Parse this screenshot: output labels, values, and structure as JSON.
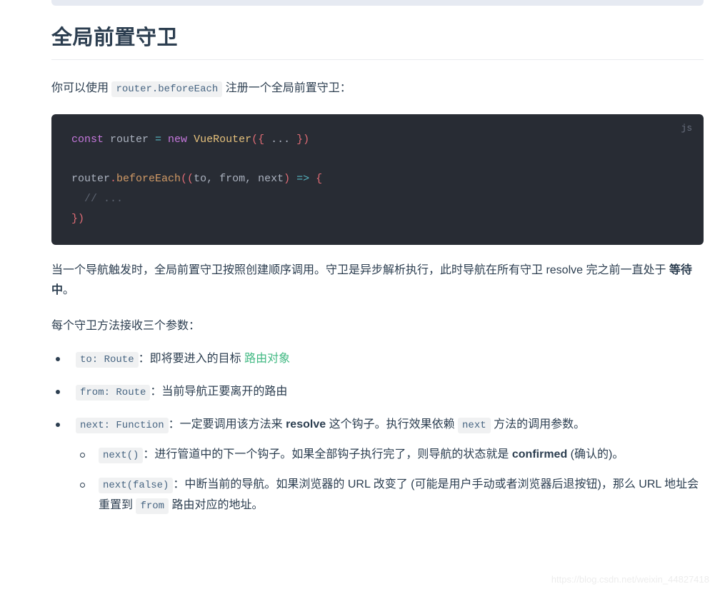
{
  "page": {
    "title": "全局前置守卫",
    "intro_before": "你可以使用",
    "intro_code": "router.beforeEach",
    "intro_after": "注册一个全局前置守卫："
  },
  "code_block": {
    "lang_label": "js",
    "lines": [
      {
        "tokens": [
          {
            "t": "const ",
            "c": "tok-kw"
          },
          {
            "t": "router ",
            "c": "tok-plain"
          },
          {
            "t": "= ",
            "c": "tok-arrow"
          },
          {
            "t": "new ",
            "c": "tok-kw"
          },
          {
            "t": "VueRouter",
            "c": "tok-cls"
          },
          {
            "t": "({ ",
            "c": "tok-punc"
          },
          {
            "t": "... ",
            "c": "tok-plain"
          },
          {
            "t": "})",
            "c": "tok-punc"
          }
        ]
      },
      {
        "tokens": []
      },
      {
        "tokens": [
          {
            "t": "router",
            "c": "tok-plain"
          },
          {
            "t": ".",
            "c": "tok-punc"
          },
          {
            "t": "beforeEach",
            "c": "tok-fn"
          },
          {
            "t": "((",
            "c": "tok-punc"
          },
          {
            "t": "to, from, next",
            "c": "tok-plain"
          },
          {
            "t": ")",
            "c": "tok-punc"
          },
          {
            "t": " => ",
            "c": "tok-arrow"
          },
          {
            "t": "{",
            "c": "tok-punc"
          }
        ]
      },
      {
        "tokens": [
          {
            "t": "  // ...",
            "c": "tok-comment"
          }
        ]
      },
      {
        "tokens": [
          {
            "t": "})",
            "c": "tok-punc"
          }
        ]
      }
    ]
  },
  "paragraphs": {
    "p1_part1": "当一个导航触发时，全局前置守卫按照创建顺序调用。守卫是异步解析执行，此时导航在所有守卫 resolve 完之前一直处于 ",
    "p1_bold": "等待中",
    "p1_part2": "。",
    "p2": "每个守卫方法接收三个参数："
  },
  "bullets": [
    {
      "code": "to: Route",
      "text_before": "：即将要进入的目标 ",
      "link": "路由对象",
      "text_after": ""
    },
    {
      "code": "from: Route",
      "text_before": "：当前导航正要离开的路由",
      "link": "",
      "text_after": ""
    },
    {
      "code": "next: Function",
      "text_before": "：一定要调用该方法来 ",
      "bold": "resolve",
      "text_mid": " 这个钩子。执行效果依赖 ",
      "code2": "next",
      "text_after": " 方法的调用参数。"
    }
  ],
  "sub_bullets": [
    {
      "code": "next()",
      "text_before": "：进行管道中的下一个钩子。如果全部钩子执行完了，则导航的状态就是 ",
      "bold": "confirmed",
      "text_after": " (确认的)。"
    },
    {
      "code": "next(false)",
      "text_before": "：中断当前的导航。如果浏览器的 URL 改变了 (可能是用户手动或者浏览器后退按钮)，那么 URL 地址会重置到 ",
      "code2": "from",
      "text_after": " 路由对应的地址。"
    }
  ],
  "watermark": "https://blog.csdn.net/weixin_44827418",
  "colors": {
    "heading": "#2c3e50",
    "link_green": "#42b983",
    "code_bg": "#282c34",
    "inline_code_bg": "#f0f1f2",
    "inline_code_text": "#476582",
    "top_band": "#e6eaf2"
  }
}
